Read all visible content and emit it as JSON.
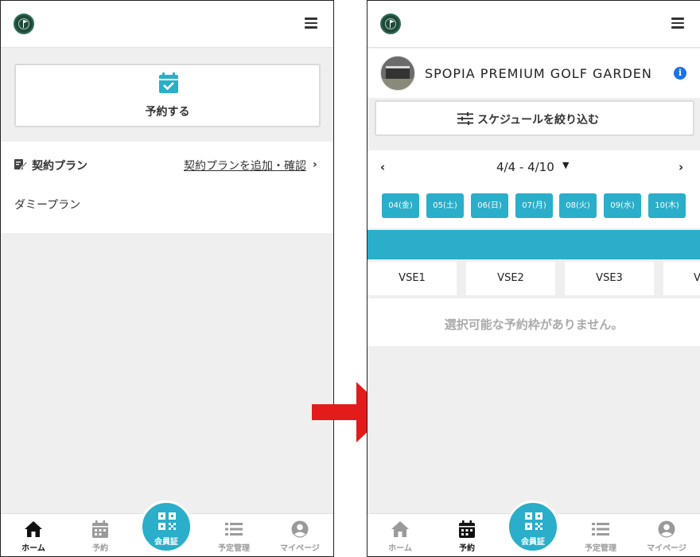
{
  "colors": {
    "accent": "#2aaec9",
    "arrow": "#e31b1b",
    "info": "#1a73e8"
  },
  "left_screen": {
    "reserve_button": {
      "label": "予約する",
      "icon": "calendar-check-icon"
    },
    "contract_plan": {
      "title": "契約プラン",
      "link_label": "契約プランを追加・確認",
      "plan_name": "ダミープラン"
    },
    "bottom_nav": {
      "home": "ホーム",
      "reserve": "予約",
      "member": "会員証",
      "schedule": "予定管理",
      "mypage": "マイページ",
      "active": "home"
    }
  },
  "right_screen": {
    "facility_name": "SPOPIA PREMIUM GOLF GARDEN",
    "filter_label": "スケジュールを絞り込む",
    "date_range": "4/4 - 4/10",
    "days": [
      "04(金)",
      "05(土)",
      "06(日)",
      "07(月)",
      "08(火)",
      "09(水)",
      "10(木)"
    ],
    "bays": [
      "VSE1",
      "VSE2",
      "VSE3",
      "V"
    ],
    "empty_message": "選択可能な予約枠がありません。",
    "bottom_nav": {
      "home": "ホーム",
      "reserve": "予約",
      "member": "会員証",
      "schedule": "予定管理",
      "mypage": "マイページ",
      "active": "reserve"
    }
  }
}
